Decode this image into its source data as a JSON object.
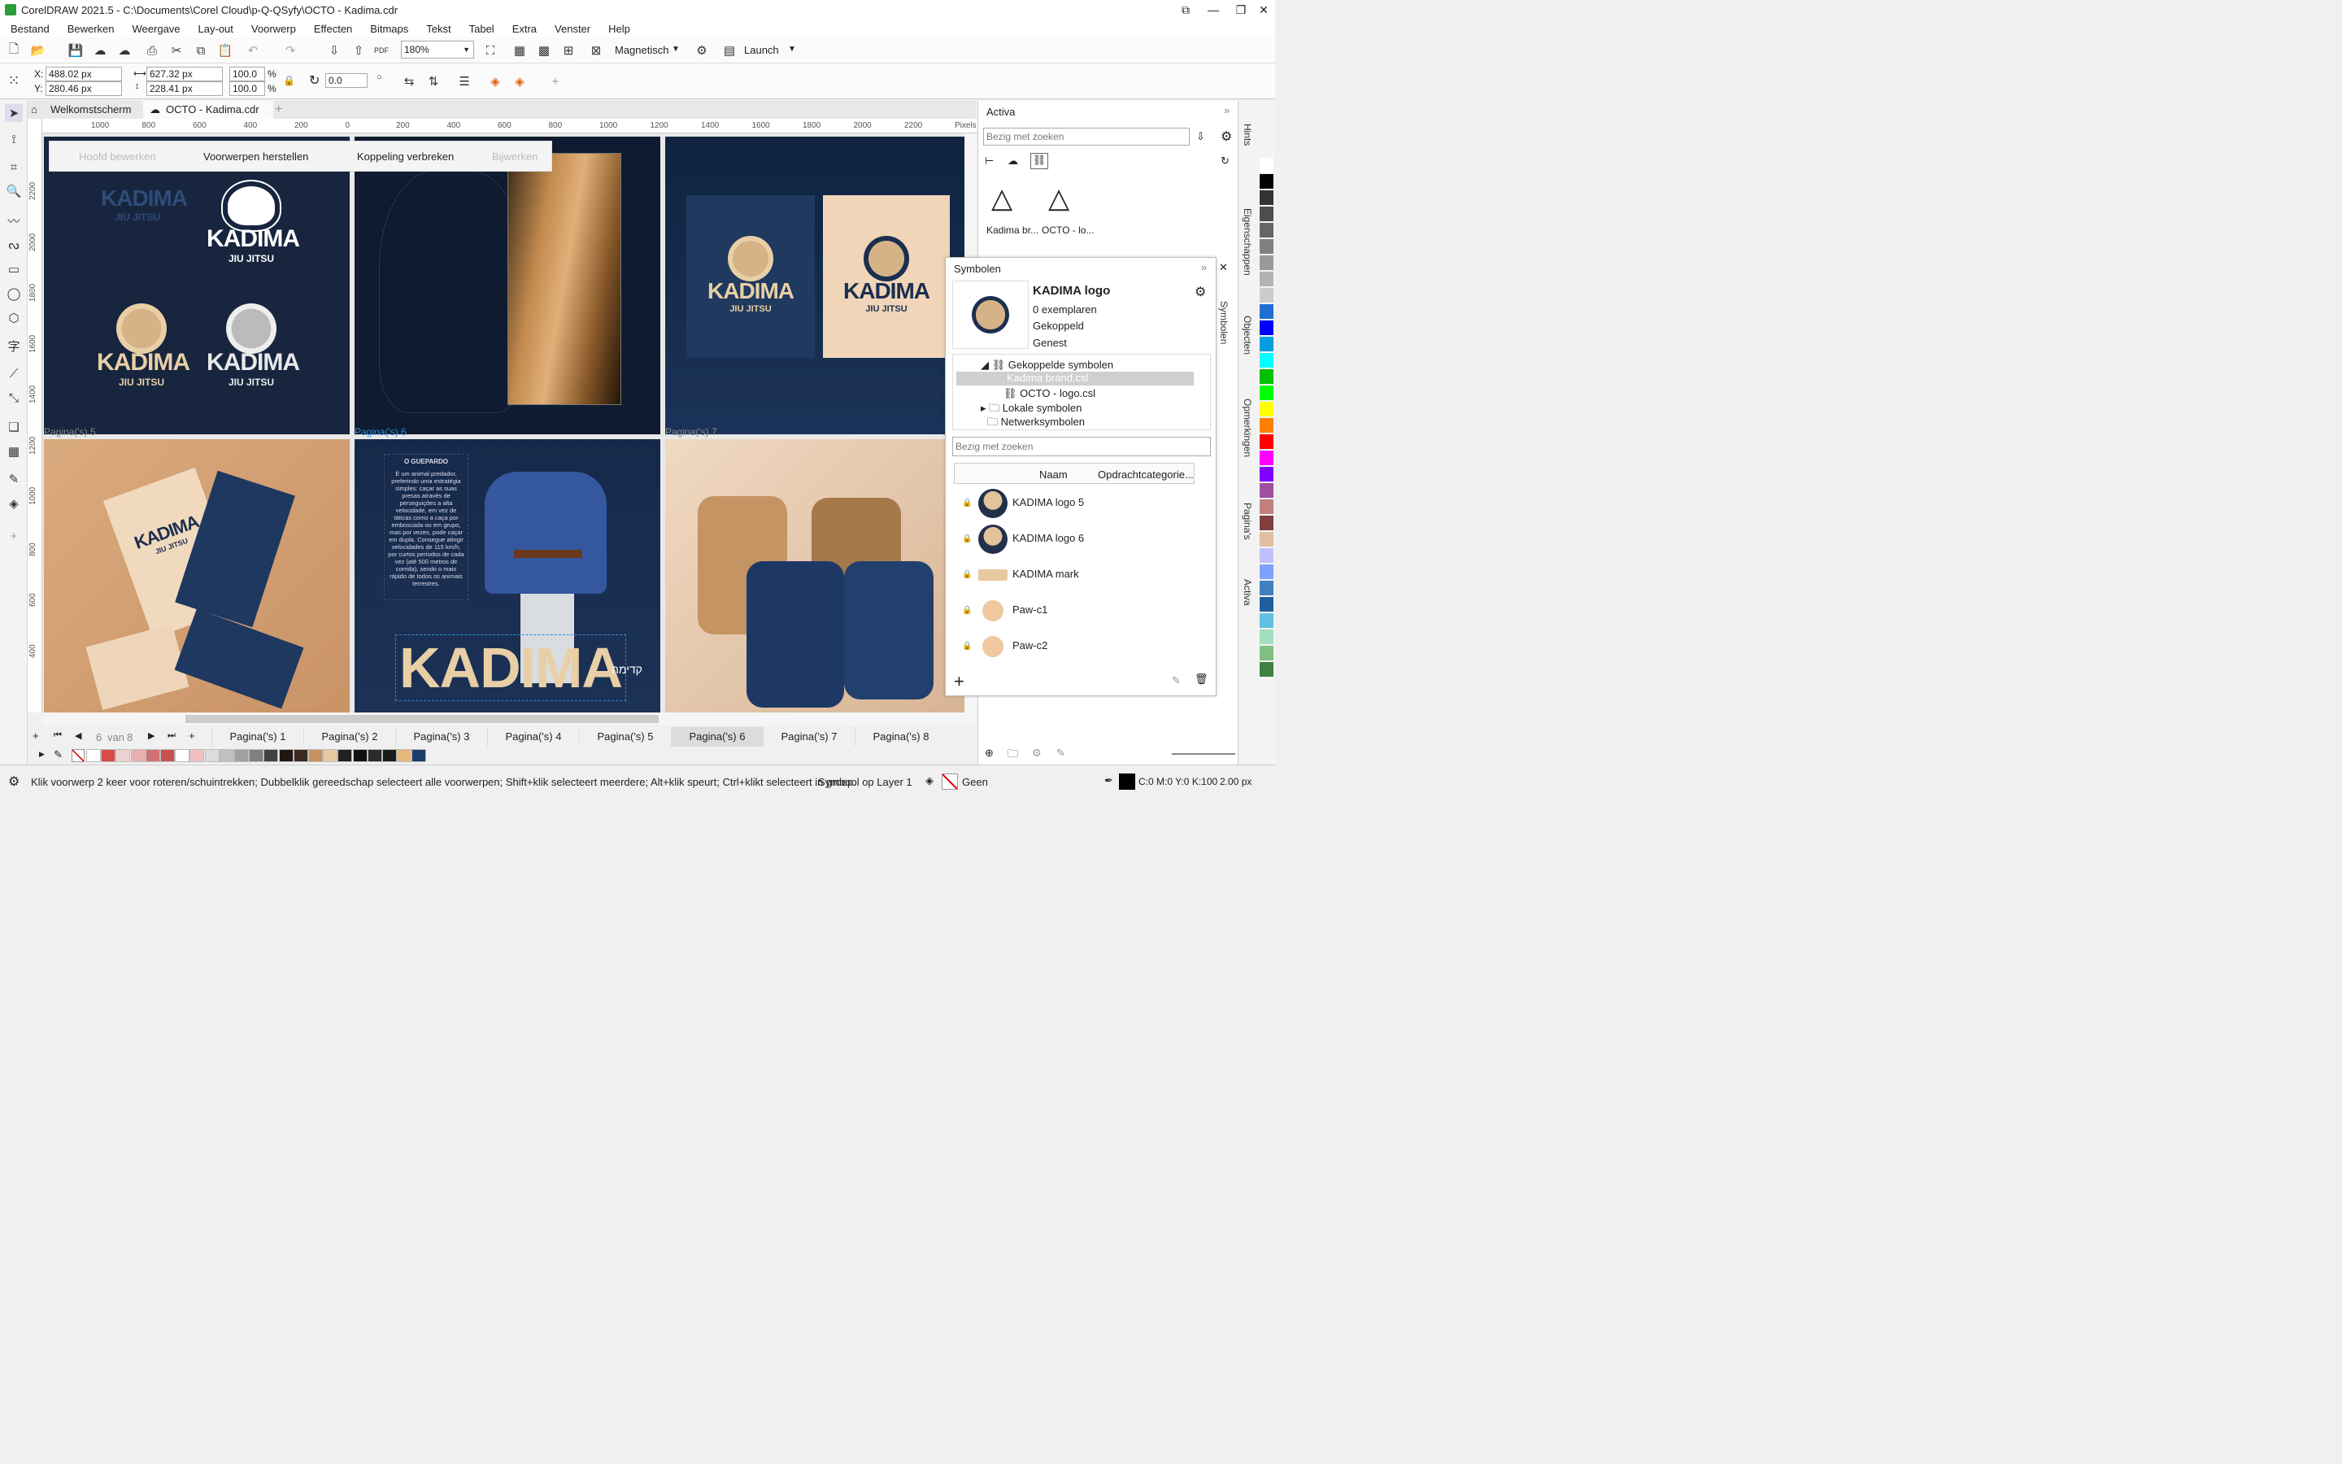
{
  "window": {
    "title": "CorelDRAW 2021.5 - C:\\Documents\\Corel Cloud\\p-Q-QSyfy\\OCTO - Kadima.cdr"
  },
  "menu": [
    "Bestand",
    "Bewerken",
    "Weergave",
    "Lay-out",
    "Voorwerp",
    "Effecten",
    "Bitmaps",
    "Tekst",
    "Tabel",
    "Extra",
    "Venster",
    "Help"
  ],
  "toolbar": {
    "zoom": "180%",
    "snap": "Magnetisch",
    "launch": "Launch"
  },
  "props": {
    "x_label": "X:",
    "x": "488.02 px",
    "y_label": "Y:",
    "y": "280.46 px",
    "w": "627.32 px",
    "h": "228.41 px",
    "sx": "100.0",
    "sy": "100.0",
    "pct": "%",
    "angle": "0.0"
  },
  "tabs": {
    "welcome": "Welkomstscherm",
    "doc": "OCTO - Kadima.cdr"
  },
  "ruler": {
    "h": [
      "1000",
      "800",
      "600",
      "400",
      "200",
      "0",
      "200",
      "400",
      "600",
      "800",
      "1000",
      "1200",
      "1400",
      "1600",
      "1800",
      "2000",
      "2200"
    ],
    "unit": "Pixels",
    "v": [
      "2200",
      "2000",
      "1800",
      "1600",
      "1400",
      "1200",
      "1000",
      "800",
      "600",
      "400"
    ]
  },
  "linkbar": {
    "edit": "Hoofd bewerken",
    "restore": "Voorwerpen herstellen",
    "break": "Koppeling verbreken",
    "update": "Bijwerken"
  },
  "pages": {
    "p5": "Pagina('s) 5",
    "p6": "Pagina('s) 6",
    "p7": "Pagina('s) 7"
  },
  "artwork": {
    "brand": "KADIMA",
    "sub": "JIU JITSU",
    "hebrew": "קדימה",
    "cheetah_title": "O GUEPARDO",
    "cheetah_text": "É um animal predador, preferindo uma estratégia simples: caçar as suas presas através de perseguições a alta velocidade, em vez de táticas como a caça por emboscada ou em grupo, mas por vezes, pode caçar em dupla. Consegue atingir velocidades de 115 km/h, por curtos períodos de cada vez (até 500 metros de corrida), sendo o mais rápido de todos os animais terrestres."
  },
  "pagenav": {
    "current": "6",
    "of": "van",
    "total": "8",
    "tabs": [
      "Pagina('s) 1",
      "Pagina('s) 2",
      "Pagina('s) 3",
      "Pagina('s) 4",
      "Pagina('s) 5",
      "Pagina('s) 6",
      "Pagina('s) 7",
      "Pagina('s) 8"
    ],
    "active": 5
  },
  "palette": [
    "#ffffff",
    "#d94a4a",
    "#efd3d3",
    "#e8b0b0",
    "#d07070",
    "#c85050",
    "#ffffff",
    "#f0c0c0",
    "#dcdcdc",
    "#c0c0c0",
    "#a0a0a0",
    "#7f7f7f",
    "#404040",
    "#201810",
    "#3a2a20",
    "#c8905a",
    "#e8c8a0",
    "#202020",
    "#101010",
    "#2a2a2a",
    "#1a1a1a",
    "#e8b87a",
    "#1c3a6c"
  ],
  "activa": {
    "title": "Activa",
    "search": "Bezig met zoeken",
    "items": [
      "Kadima br...",
      "OCTO - lo..."
    ]
  },
  "symbols": {
    "title": "Symbolen",
    "name": "KADIMA logo",
    "instances": "0 exemplaren",
    "linked": "Gekoppeld",
    "nested": "Genest",
    "tree": [
      "Gekoppelde symbolen",
      "Kadima brand.csl",
      "OCTO - logo.csl",
      "Lokale symbolen",
      "Netwerksymbolen"
    ],
    "search": "Bezig met zoeken",
    "col_name": "Naam",
    "col_cat": "Opdrachtcategorie...",
    "rows": [
      "KADIMA logo 5",
      "KADIMA logo 6",
      "KADIMA mark",
      "Paw-c1",
      "Paw-c2"
    ]
  },
  "dockertabs": [
    "Hints",
    "Eigenschappen",
    "Objecten",
    "Opmerkingen",
    "Pagina's",
    "Activa",
    "Symbolen"
  ],
  "colorpalette": [
    "#ffffff",
    "#000000",
    "#333333",
    "#4d4d4d",
    "#666666",
    "#808080",
    "#999999",
    "#b3b3b3",
    "#cccccc",
    "#1f6fd0",
    "#0000ff",
    "#00a0e0",
    "#00ffff",
    "#00c000",
    "#00ff00",
    "#ffff00",
    "#ff8000",
    "#ff0000",
    "#ff00ff",
    "#8000ff",
    "#a050a0",
    "#c08080",
    "#804040",
    "#e0c0a0",
    "#c0c0ff",
    "#80a0ff",
    "#4080c0",
    "#2060a0",
    "#60c0e0",
    "#a0e0c0",
    "#80c080",
    "#408040"
  ],
  "status": {
    "hint": "Klik voorwerp 2 keer voor roteren/schuintrekken; Dubbelklik gereedschap selecteert alle voorwerpen; Shift+klik selecteert meerdere; Alt+klik speurt; Ctrl+klikt selecteert in groep.",
    "layer": "Symbool op Layer 1",
    "fill": "Geen",
    "color": "C:0 M:0 Y:0 K:100",
    "width": "2.00 px"
  }
}
